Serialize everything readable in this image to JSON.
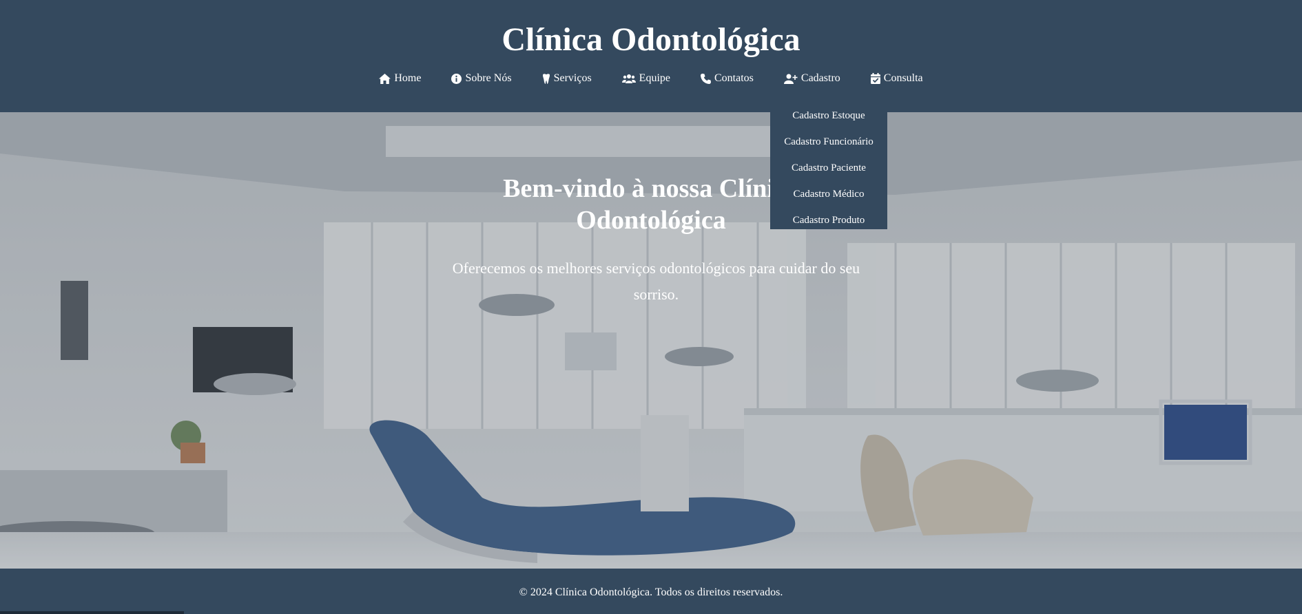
{
  "header": {
    "site_title": "Clínica Odontológica"
  },
  "nav": {
    "items": [
      {
        "label": "Home",
        "icon": "home-icon"
      },
      {
        "label": "Sobre Nós",
        "icon": "info-icon"
      },
      {
        "label": "Serviços",
        "icon": "tooth-icon"
      },
      {
        "label": "Equipe",
        "icon": "users-icon"
      },
      {
        "label": "Contatos",
        "icon": "phone-icon"
      },
      {
        "label": "Cadastro",
        "icon": "user-plus-icon"
      },
      {
        "label": "Consulta",
        "icon": "calendar-check-icon"
      }
    ],
    "cadastro_dropdown": [
      "Cadastro Estoque",
      "Cadastro Funcionário",
      "Cadastro Paciente",
      "Cadastro Médico",
      "Cadastro Produto"
    ]
  },
  "hero": {
    "title": "Bem-vindo à nossa Clínica Odontológica",
    "text": "Oferecemos os melhores serviços odontológicos para cuidar do seu sorriso.",
    "background": "dental-office-photo"
  },
  "footer": {
    "text": "© 2024 Clínica Odontológica. Todos os direitos reservados."
  },
  "colors": {
    "primary": "#34495e",
    "text": "#ffffff"
  }
}
